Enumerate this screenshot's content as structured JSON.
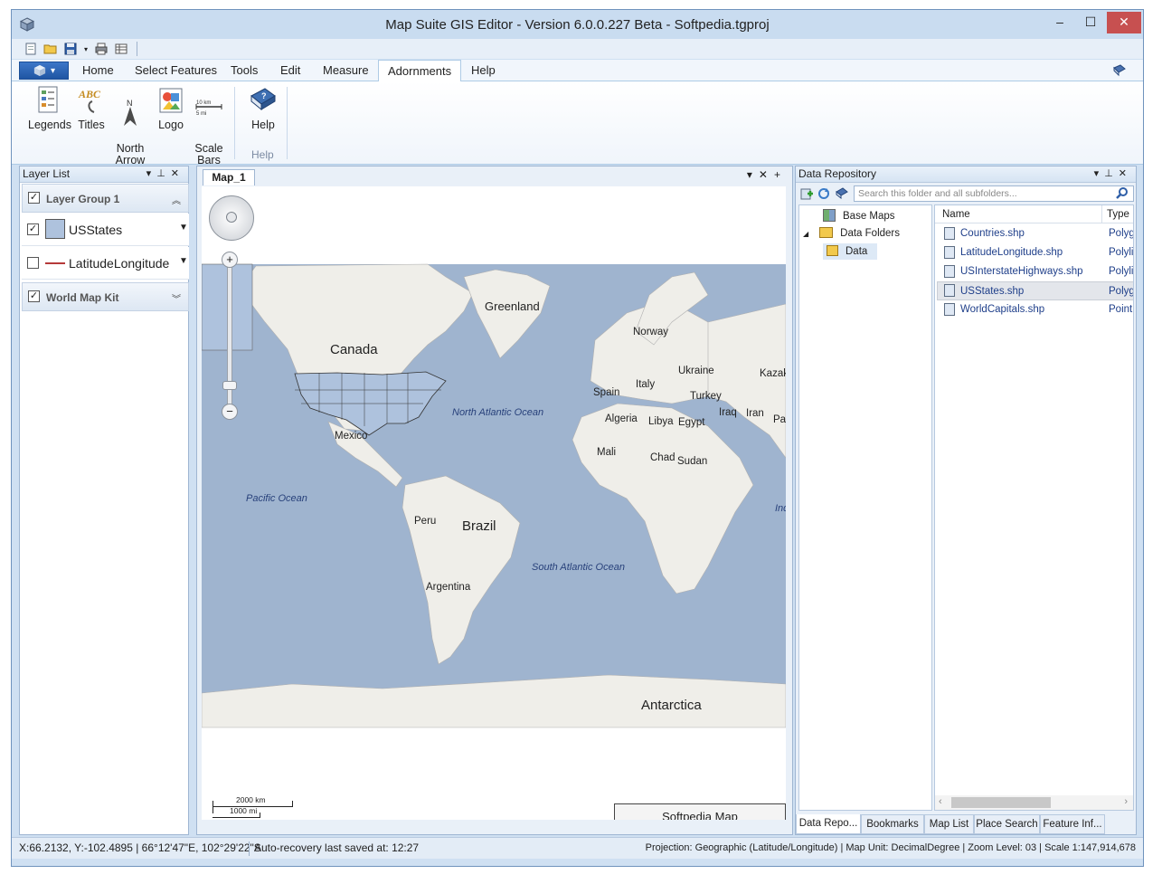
{
  "window": {
    "title": "Map Suite GIS Editor - Version 6.0.0.227 Beta - Softpedia.tgproj",
    "controls": {
      "minimize": "–",
      "maximize": "☐",
      "close": "✕"
    }
  },
  "ribbon": {
    "tabs": [
      "Home",
      "Select Features",
      "Tools",
      "Edit",
      "Measure",
      "Adornments",
      "Help"
    ],
    "active_tab": "Adornments",
    "buttons": [
      {
        "label": "Legends",
        "icon": "legends-icon"
      },
      {
        "label": "Titles",
        "icon": "titles-icon"
      },
      {
        "label": "North\nArrow",
        "icon": "north-arrow-icon"
      },
      {
        "label": "Logo",
        "icon": "logo-icon"
      },
      {
        "label": "Scale\nBars",
        "icon": "scale-bars-icon"
      },
      {
        "label": "Help",
        "icon": "help-book-icon"
      }
    ],
    "groups": [
      "Help"
    ]
  },
  "layer_list": {
    "title": "Layer List",
    "groups": [
      {
        "name": "Layer Group 1",
        "checked": true,
        "expanded": true
      },
      {
        "name": "World Map Kit",
        "checked": true,
        "expanded": false
      }
    ],
    "layers": [
      {
        "name": "USStates",
        "checked": true,
        "swatch": "#aec2dd"
      },
      {
        "name": "LatitudeLongitude",
        "checked": false,
        "swatch": "#b53a3a"
      }
    ]
  },
  "map": {
    "tab_title": "Map_1",
    "labels": {
      "greenland": "Greenland",
      "canada": "Canada",
      "norway": "Norway",
      "ukraine": "Ukraine",
      "kazak": "Kazak",
      "spain": "Spain",
      "italy": "Italy",
      "turkey": "Turkey",
      "iraq": "Iraq",
      "iran": "Iran",
      "pa": "Pa",
      "north_atlantic": "North Atlantic Ocean",
      "mexico": "Mexico",
      "algeria": "Algeria",
      "libya": "Libya",
      "egypt": "Egypt",
      "mali": "Mali",
      "chad": "Chad",
      "sudan": "Sudan",
      "pacific": "Pacific Ocean",
      "indian": "Ind",
      "peru": "Peru",
      "brazil": "Brazil",
      "south_atlantic": "South Atlantic Ocean",
      "argentina": "Argentina",
      "antarctica": "Antarctica"
    },
    "scale_bar": {
      "km": "2000 km",
      "mi": "1000 mi"
    },
    "title_box": "Softpedia Map",
    "colors": {
      "ocean": "#9fb4cf",
      "land": "#efeee9",
      "usstates": "#aec2dd"
    }
  },
  "data_repository": {
    "title": "Data Repository",
    "search_placeholder": "Search this folder and all subfolders...",
    "tree": [
      {
        "label": "Base Maps",
        "level": 1
      },
      {
        "label": "Data Folders",
        "level": 1
      },
      {
        "label": "Data",
        "level": 2
      }
    ],
    "columns": [
      "Name",
      "Type"
    ],
    "files": [
      {
        "name": "Countries.shp",
        "type": "Polyg"
      },
      {
        "name": "LatitudeLongitude.shp",
        "type": "Polyli"
      },
      {
        "name": "USInterstateHighways.shp",
        "type": "Polyli"
      },
      {
        "name": "USStates.shp",
        "type": "Polyg"
      },
      {
        "name": "WorldCapitals.shp",
        "type": "Point"
      }
    ],
    "selected_file": "USStates.shp"
  },
  "bottom_tabs": [
    "Data Repo...",
    "Bookmarks",
    "Map List",
    "Place Search",
    "Feature Inf..."
  ],
  "status": {
    "coords": "X:66.2132, Y:-102.4895 | 66°12'47\"E, 102°29'22\"S",
    "autosave": "Auto-recovery last saved at: 12:27",
    "info": "Projection: Geographic (Latitude/Longitude) | Map Unit: DecimalDegree | Zoom Level: 03 | Scale 1:147,914,678"
  }
}
